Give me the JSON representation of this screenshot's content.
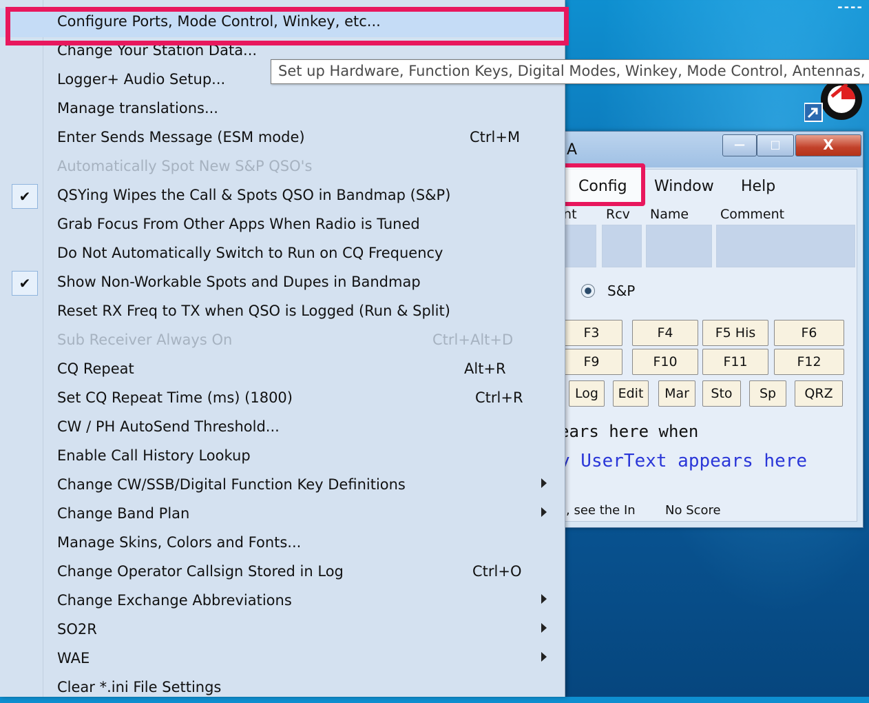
{
  "desktop": {
    "corner_text": "----"
  },
  "menu": {
    "items": [
      {
        "label": "Configure Ports, Mode Control, Winkey, etc...",
        "shortcut": "",
        "disabled": false,
        "checked": false,
        "submenu": false
      },
      {
        "label": "Change Your Station Data...",
        "shortcut": "",
        "disabled": false,
        "checked": false,
        "submenu": false
      },
      {
        "label": "Logger+ Audio Setup...",
        "shortcut": "",
        "disabled": false,
        "checked": false,
        "submenu": false
      },
      {
        "label": "Manage translations...",
        "shortcut": "",
        "disabled": false,
        "checked": false,
        "submenu": false
      },
      {
        "label": "Enter Sends Message (ESM mode)",
        "shortcut": "Ctrl+M",
        "disabled": false,
        "checked": false,
        "submenu": false
      },
      {
        "label": "Automatically Spot New S&P QSO's",
        "shortcut": "",
        "disabled": true,
        "checked": false,
        "submenu": false
      },
      {
        "label": "QSYing Wipes the Call & Spots QSO in Bandmap (S&P)",
        "shortcut": "",
        "disabled": false,
        "checked": true,
        "submenu": false
      },
      {
        "label": "Grab Focus From Other Apps When Radio is Tuned",
        "shortcut": "",
        "disabled": false,
        "checked": false,
        "submenu": false
      },
      {
        "label": "Do Not Automatically Switch to Run on CQ Frequency",
        "shortcut": "",
        "disabled": false,
        "checked": false,
        "submenu": false
      },
      {
        "label": "Show Non-Workable Spots and Dupes in Bandmap",
        "shortcut": "",
        "disabled": false,
        "checked": true,
        "submenu": false
      },
      {
        "label": "Reset RX Freq to TX when QSO is Logged (Run & Split)",
        "shortcut": "",
        "disabled": false,
        "checked": false,
        "submenu": false
      },
      {
        "label": "Sub Receiver Always On",
        "shortcut": "Ctrl+Alt+D",
        "disabled": true,
        "checked": false,
        "submenu": false
      },
      {
        "label": "CQ Repeat",
        "shortcut": "Alt+R",
        "disabled": false,
        "checked": false,
        "submenu": false
      },
      {
        "label": "Set CQ Repeat Time (ms) (1800)",
        "shortcut": "Ctrl+R",
        "disabled": false,
        "checked": false,
        "submenu": false
      },
      {
        "label": "CW / PH AutoSend Threshold...",
        "shortcut": "",
        "disabled": false,
        "checked": false,
        "submenu": false
      },
      {
        "label": "Enable Call History Lookup",
        "shortcut": "",
        "disabled": false,
        "checked": false,
        "submenu": false
      },
      {
        "label": "Change CW/SSB/Digital Function Key Definitions",
        "shortcut": "",
        "disabled": false,
        "checked": false,
        "submenu": true
      },
      {
        "label": "Change Band Plan",
        "shortcut": "",
        "disabled": false,
        "checked": false,
        "submenu": true
      },
      {
        "label": "Manage Skins, Colors and Fonts...",
        "shortcut": "",
        "disabled": false,
        "checked": false,
        "submenu": false
      },
      {
        "label": "Change Operator Callsign Stored in Log",
        "shortcut": "Ctrl+O",
        "disabled": false,
        "checked": false,
        "submenu": false
      },
      {
        "label": "Change Exchange Abbreviations",
        "shortcut": "",
        "disabled": false,
        "checked": false,
        "submenu": true
      },
      {
        "label": "SO2R",
        "shortcut": "",
        "disabled": false,
        "checked": false,
        "submenu": true
      },
      {
        "label": "WAE",
        "shortcut": "",
        "disabled": false,
        "checked": false,
        "submenu": true
      },
      {
        "label": "Clear *.ini File Settings",
        "shortcut": "",
        "disabled": false,
        "checked": false,
        "submenu": false
      }
    ],
    "check_glyph": "✔"
  },
  "tooltip": {
    "text": "Set up Hardware, Function Keys, Digital Modes, Winkey, Mode Control, Antennas,"
  },
  "window": {
    "title": "A",
    "caption": {
      "minimize": "—",
      "maximize": "□",
      "close": "X"
    },
    "menubar": {
      "config": "Config",
      "window": "Window",
      "help": "Help"
    },
    "columns": {
      "snt": "Snt",
      "rcv": "Rcv",
      "name": "Name",
      "comment": "Comment"
    },
    "mode_option": "S&P",
    "fkeys_row1": [
      "F3",
      "F4",
      "F5 His",
      "F6"
    ],
    "fkeys_row2": [
      "F9",
      "F10",
      "F11",
      "F12"
    ],
    "buttons_row3": [
      "Log",
      "Edit",
      "Mar",
      "Sto",
      "Sp",
      "QRZ"
    ],
    "info_text": "ears here when",
    "usertext": "y UserText appears here",
    "status_left": ", see the In",
    "status_score": "No Score"
  },
  "colors": {
    "highlight": "#e8175d",
    "usertext": "#2a36d8",
    "menu_bg": "#d4e1f0"
  }
}
